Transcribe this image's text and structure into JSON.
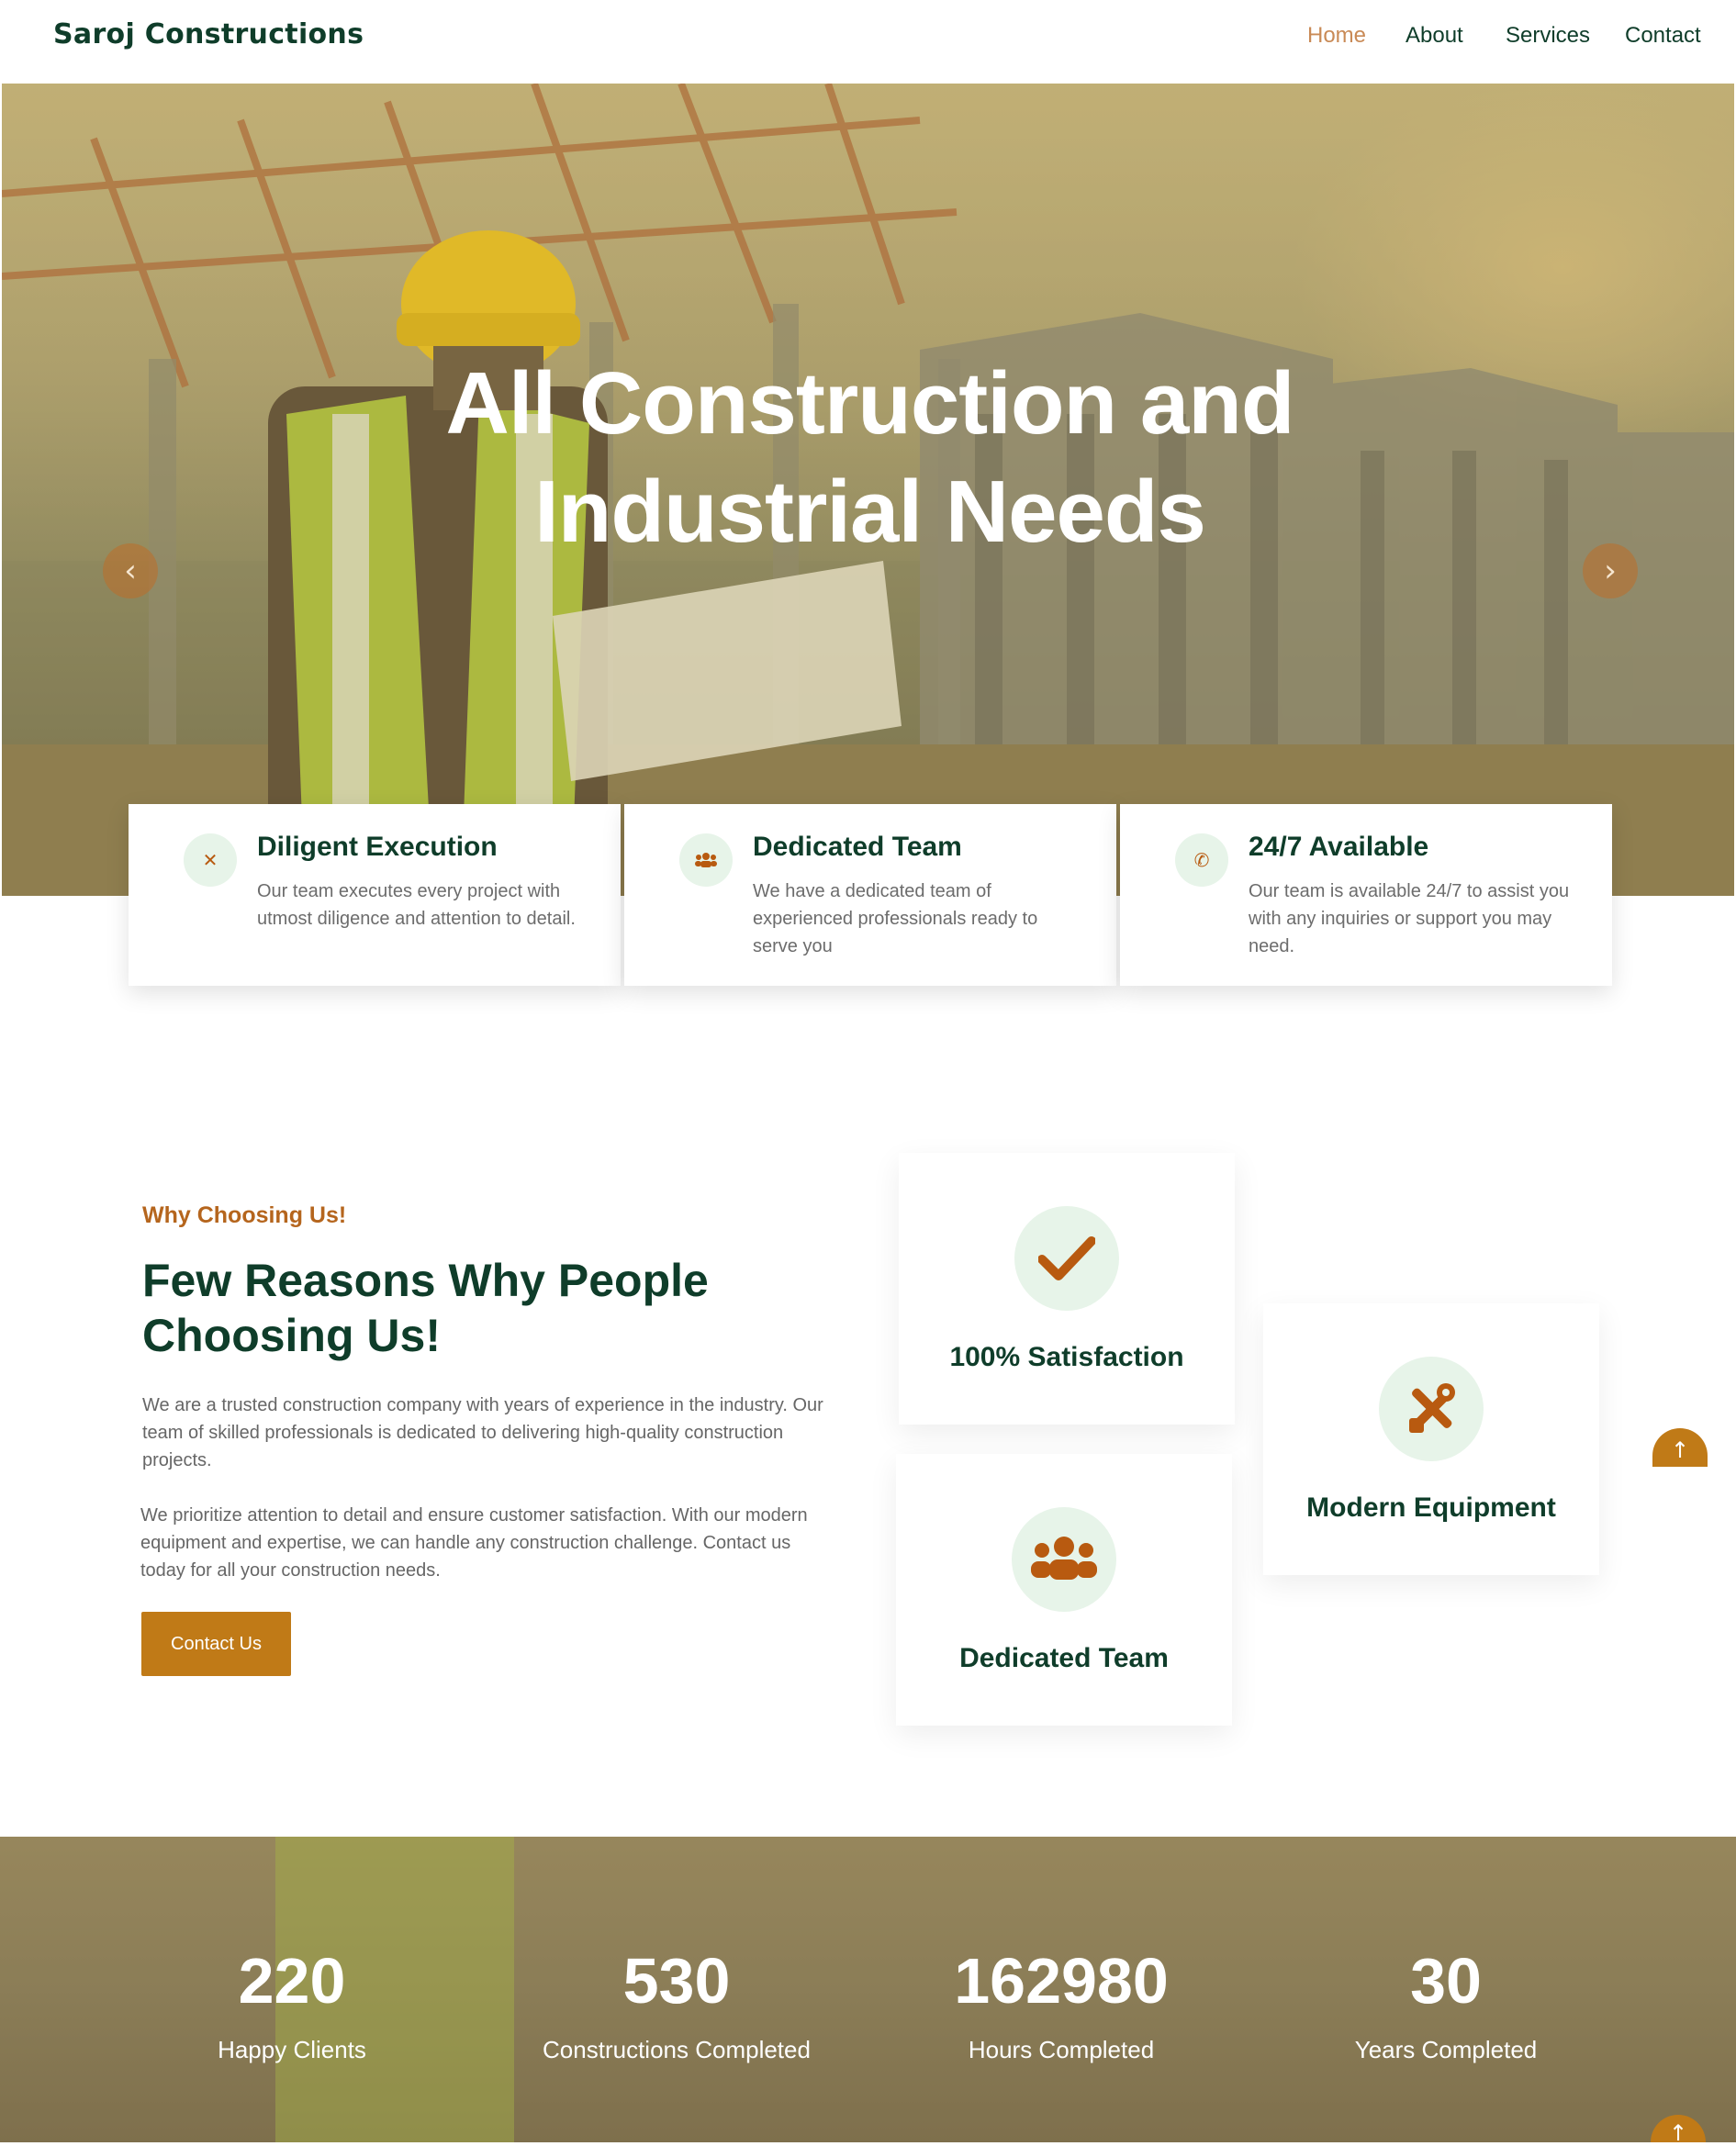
{
  "nav": {
    "brand": "Saroj Constructions",
    "links": [
      "Home",
      "About",
      "Services",
      "Contact"
    ]
  },
  "hero": {
    "title_line1": "All Construction and",
    "title_line2": "Industrial Needs",
    "prev_icon": "chevron-left-icon",
    "next_icon": "chevron-right-icon"
  },
  "features": [
    {
      "icon": "close-icon",
      "title": "Diligent Execution",
      "text": "Our team executes every project with utmost diligence and attention to detail."
    },
    {
      "icon": "users-icon",
      "title": "Dedicated Team",
      "text": "We have a dedicated team of experienced professionals ready to serve you"
    },
    {
      "icon": "phone-icon",
      "title": "24/7 Available",
      "text": "Our team is available 24/7 to assist you with any inquiries or support you may need."
    }
  ],
  "why": {
    "eyebrow": "Why Choosing Us!",
    "title": "Few Reasons Why People Choosing Us!",
    "p1": "We are a trusted construction company with years of experience in the industry. Our team of skilled professionals is dedicated to delivering high-quality construction projects.",
    "p2": "We prioritize attention to detail and ensure customer satisfaction. With our modern equipment and expertise, we can handle any construction challenge. Contact us today for all your construction needs.",
    "button": "Contact Us",
    "cards": [
      {
        "icon": "check-icon",
        "label": "100% Satisfaction"
      },
      {
        "icon": "tools-icon",
        "label": "Modern Equipment"
      },
      {
        "icon": "users-icon",
        "label": "Dedicated Team"
      }
    ]
  },
  "stats": [
    {
      "value": "220",
      "label": "Happy Clients"
    },
    {
      "value": "530",
      "label": "Constructions Completed"
    },
    {
      "value": "162980",
      "label": "Hours Completed"
    },
    {
      "value": "30",
      "label": "Years Completed"
    }
  ],
  "colors": {
    "brand_dark": "#0f3d2a",
    "accent": "#c07a17",
    "icon_bg": "#e7f4e9",
    "nav_active": "#c98a56"
  }
}
